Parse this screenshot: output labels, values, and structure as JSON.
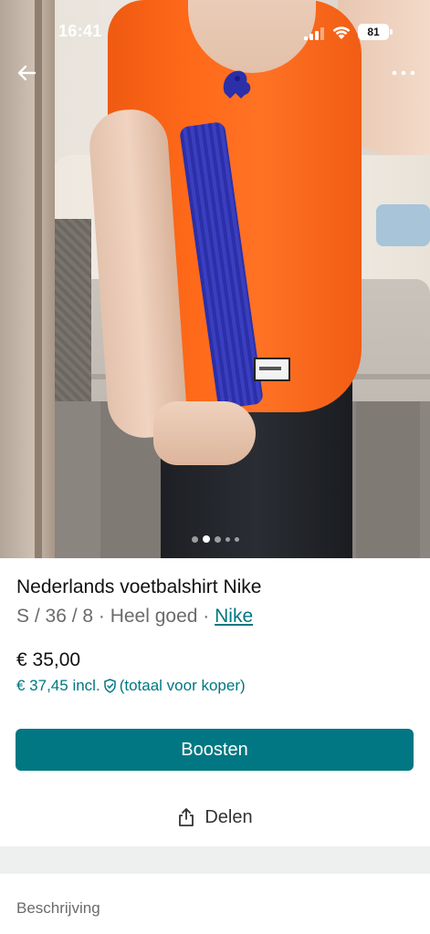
{
  "status_bar": {
    "time": "16:41",
    "battery": "81"
  },
  "product": {
    "title": "Nederlands voetbalshirt Nike",
    "subtitle_prefix": "S / 36 / 8 · Heel goed · ",
    "brand": "Nike",
    "price": "€ 35,00",
    "price_incl": "€ 37,45 incl.",
    "price_incl_note": "(totaal voor koper)"
  },
  "actions": {
    "boost_label": "Boosten",
    "share_label": "Delen"
  },
  "carousel": {
    "page_count": 5,
    "active_index": 1
  },
  "description": {
    "heading": "Beschrijving"
  },
  "colors": {
    "accent": "#007782",
    "shirt": "#ff6a1a"
  },
  "icons": {
    "back": "arrow-left-icon",
    "more": "more-dots-icon",
    "share": "share-icon",
    "shield": "shield-check-icon"
  }
}
